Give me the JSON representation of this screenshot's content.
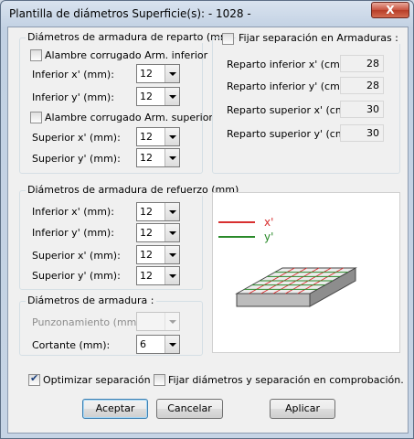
{
  "window": {
    "title": "Plantilla de diámetros Superficie(s): - 1028 -",
    "close_label": "X"
  },
  "reparto": {
    "legend": "Diámetros de armadura de reparto (mm)",
    "inferior_check_label": "Alambre corrugado Arm. inferior",
    "inferior_checked": false,
    "inferior_x_label": "Inferior x' (mm):",
    "inferior_x_value": "12",
    "inferior_y_label": "Inferior y' (mm):",
    "inferior_y_value": "12",
    "superior_check_label": "Alambre corrugado Arm. superior",
    "superior_checked": false,
    "superior_x_label": "Superior x'  (mm):",
    "superior_x_value": "12",
    "superior_y_label": "Superior y'  (mm):",
    "superior_y_value": "12"
  },
  "separacion": {
    "check_label": "Fijar separación en Armaduras :",
    "checked": false,
    "rows": [
      {
        "label": "Reparto inferior x' (cm):",
        "value": "28"
      },
      {
        "label": "Reparto inferior y' (cm):",
        "value": "28"
      },
      {
        "label": "Reparto superior x'  (cm):",
        "value": "30"
      },
      {
        "label": "Reparto superior y'  (cm):",
        "value": "30"
      }
    ]
  },
  "refuerzo": {
    "legend": "Diámetros de armadura de refuerzo (mm)",
    "rows": [
      {
        "label": "Inferior x'  (mm):",
        "value": "12"
      },
      {
        "label": "Inferior y'  (mm):",
        "value": "12"
      },
      {
        "label": "Superior x'  (mm):",
        "value": "12"
      },
      {
        "label": "Superior y'  (mm):",
        "value": "12"
      }
    ]
  },
  "armadura": {
    "legend": "Diámetros de armadura :",
    "punzonamiento_label": "Punzonamiento  (mm):",
    "punzonamiento_value": "",
    "cortante_label": "Cortante (mm):",
    "cortante_value": "6"
  },
  "preview": {
    "legend_x": "x'",
    "legend_y": "y'",
    "color_x": "#d83030",
    "color_y": "#2a8a2a"
  },
  "options": {
    "optimizar_label": "Optimizar separación",
    "optimizar_checked": true,
    "fijar_label": "Fijar diámetros y separación en comprobación.",
    "fijar_checked": false
  },
  "buttons": {
    "aceptar": "Aceptar",
    "cancelar": "Cancelar",
    "aplicar": "Aplicar"
  }
}
